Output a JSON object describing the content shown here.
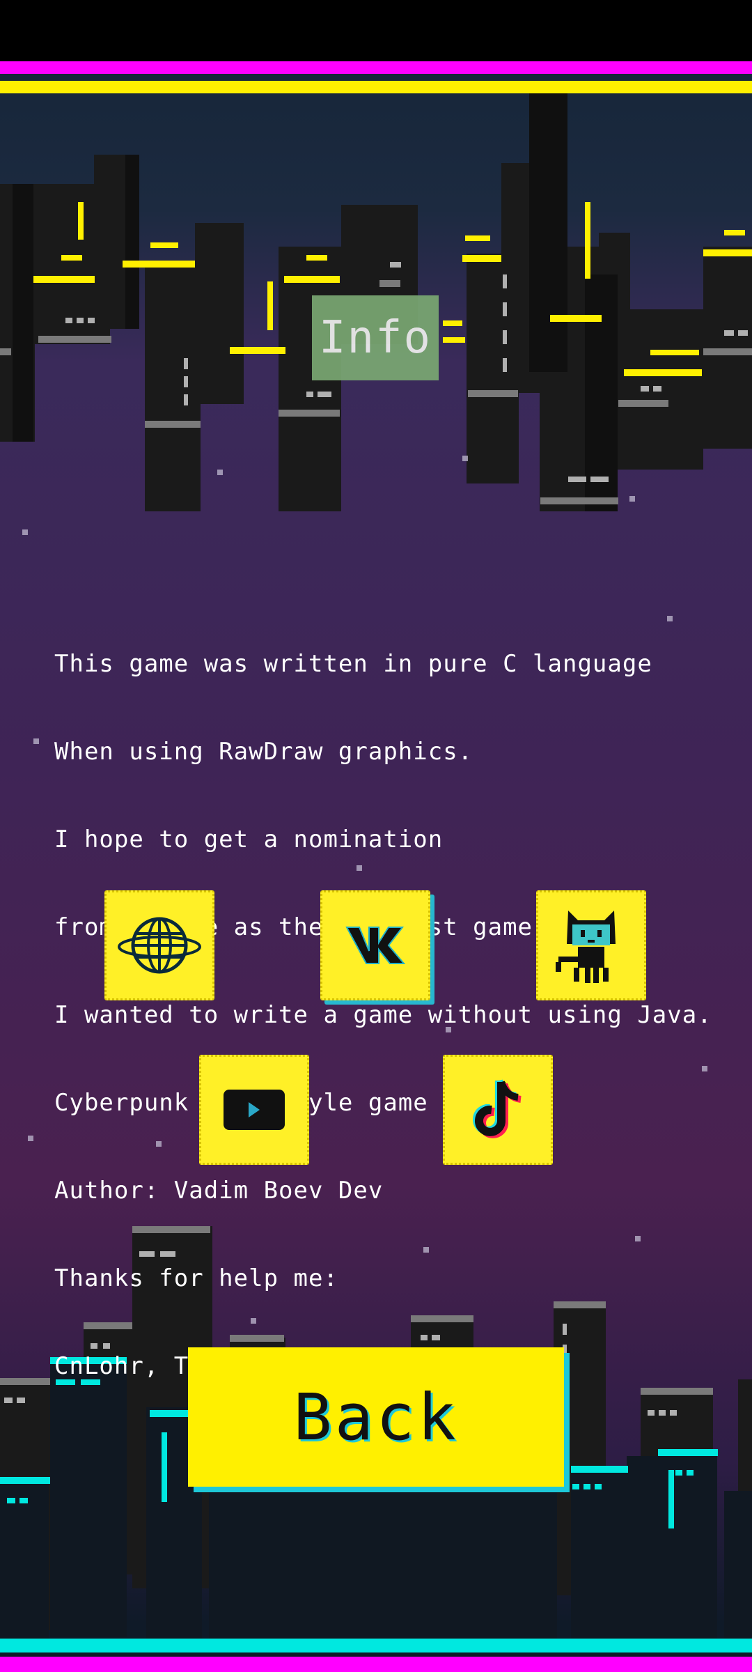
{
  "header": {
    "title": "Info"
  },
  "info": {
    "lines": [
      "This game was written in pure C language",
      "When using RawDraw graphics.",
      "I hope to get a nomination",
      "from Google as the smallest game.",
      "I wanted to write a game without using Java.",
      "Cyberpunk 2077 style game",
      "Author: Vadim Boev Dev",
      "Thanks for help me:",
      "CnLohr, Tempo and other.."
    ]
  },
  "links": [
    {
      "id": "website",
      "icon": "globe-icon"
    },
    {
      "id": "vk",
      "icon": "vk-icon"
    },
    {
      "id": "github",
      "icon": "github-octocat-icon"
    },
    {
      "id": "youtube",
      "icon": "youtube-play-icon"
    },
    {
      "id": "tiktok",
      "icon": "tiktok-icon"
    }
  ],
  "back_button": {
    "label": "Back"
  },
  "colors": {
    "accent_yellow": "#fff000",
    "magenta": "#ff00ff",
    "cyan": "#00e8e0",
    "info_box": "#7aa872"
  }
}
